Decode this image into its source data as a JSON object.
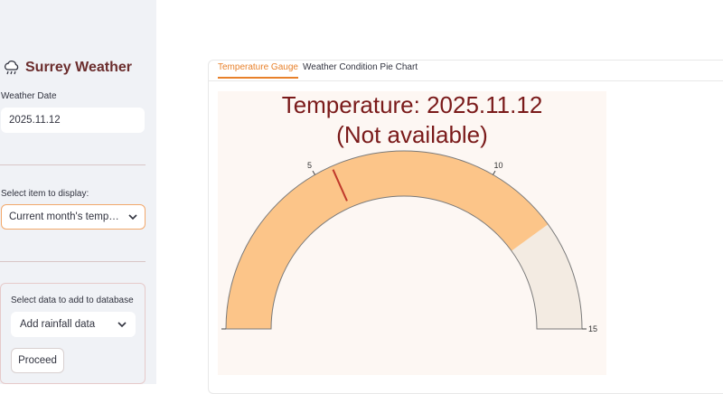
{
  "sidebar": {
    "app_title": "Surrey Weather",
    "weather_date_label": "Weather Date",
    "weather_date_value": "2025.11.12",
    "select_item_label": "Select item to display:",
    "select_item_value": "Current month's temp…",
    "add_data_label": "Select data to add to database",
    "add_data_value": "Add rainfall data",
    "proceed_label": "Proceed"
  },
  "tabs": [
    {
      "label": "Temperature Gauge",
      "active": true
    },
    {
      "label": "Weather Condition Pie Chart",
      "active": false
    }
  ],
  "chart_data": {
    "type": "gauge",
    "title_line1": "Temperature: 2025.11.12",
    "title_line2": "(Not available)",
    "range": [
      0,
      15
    ],
    "ticks": [
      0,
      5,
      10,
      15
    ],
    "bar_value": 12,
    "threshold_value": 5.5,
    "colors": {
      "bar": "#fcc589",
      "rest": "#f3ebe2",
      "threshold": "#c0392b",
      "title": "#7a1a1a",
      "background": "#fdf7f3"
    }
  }
}
